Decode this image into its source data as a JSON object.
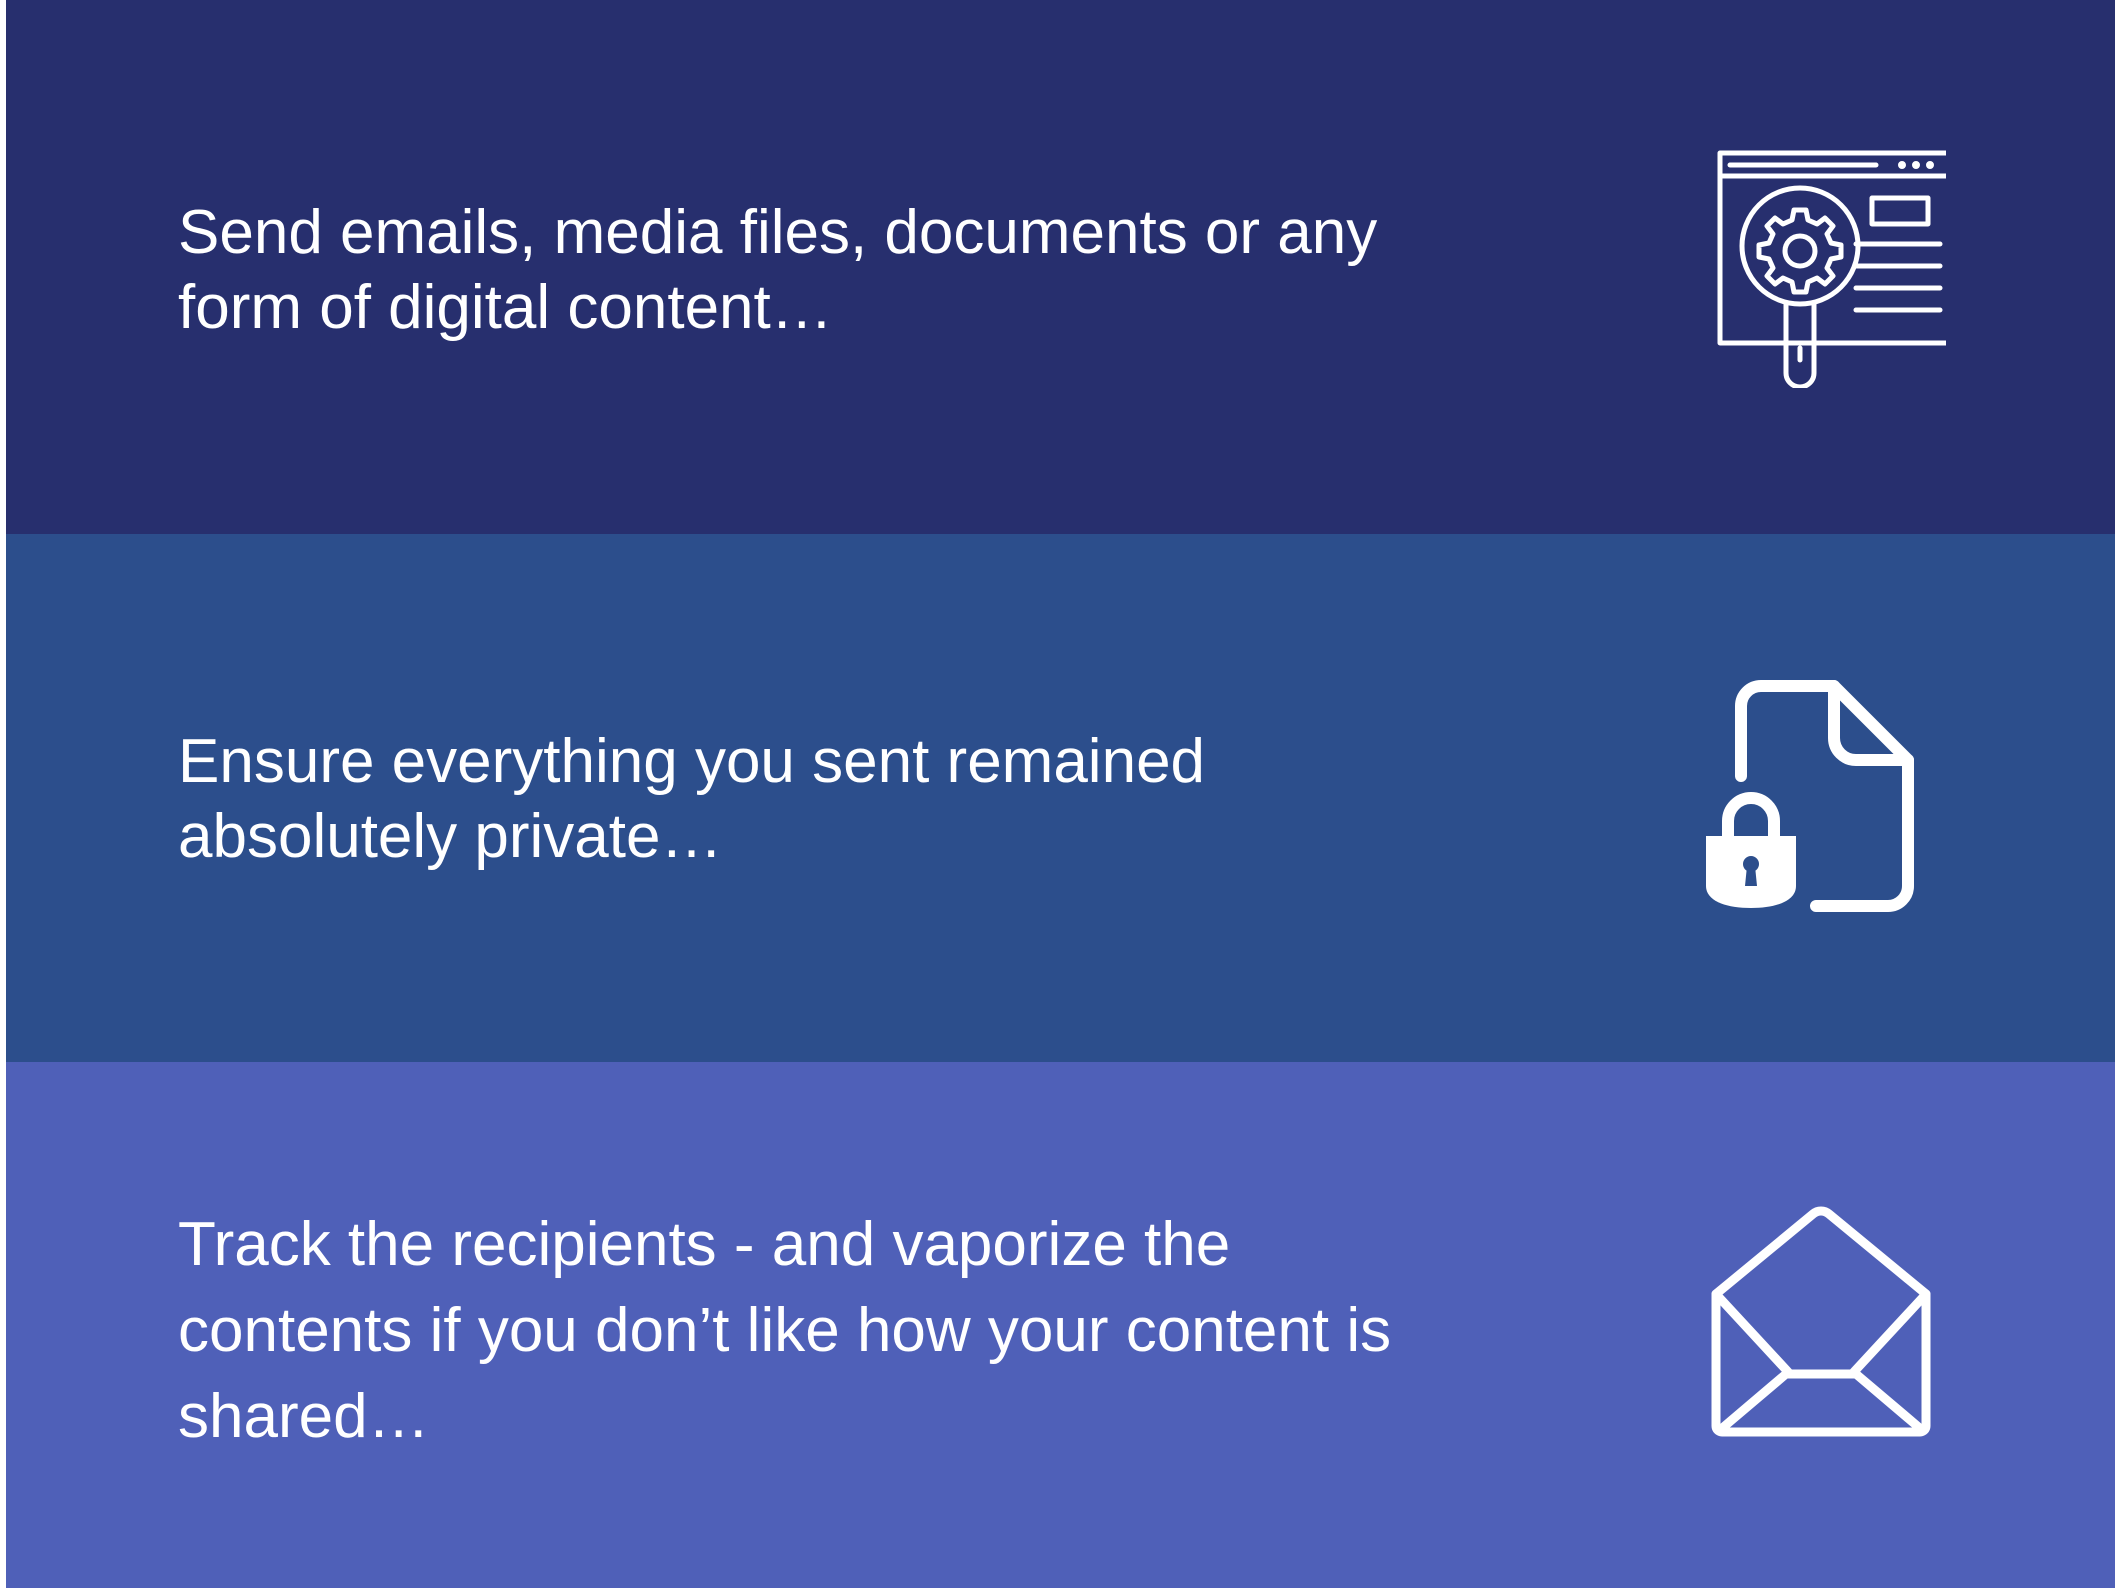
{
  "colors": {
    "band_1": "#272f6e",
    "band_2": "#2c4e8c",
    "band_3": "#4f60b8",
    "text": "#ffffff"
  },
  "bands": [
    {
      "text": "Send emails, media files, documents or any\nform of digital content…",
      "icon": "browser-settings-search-icon"
    },
    {
      "text": "Ensure everything you sent remained\nabsolutely private…",
      "icon": "locked-document-icon"
    },
    {
      "text": "Track the recipients - and vaporize the\ncontents if you don’t like how your content is\nshared…",
      "icon": "open-envelope-icon"
    }
  ]
}
